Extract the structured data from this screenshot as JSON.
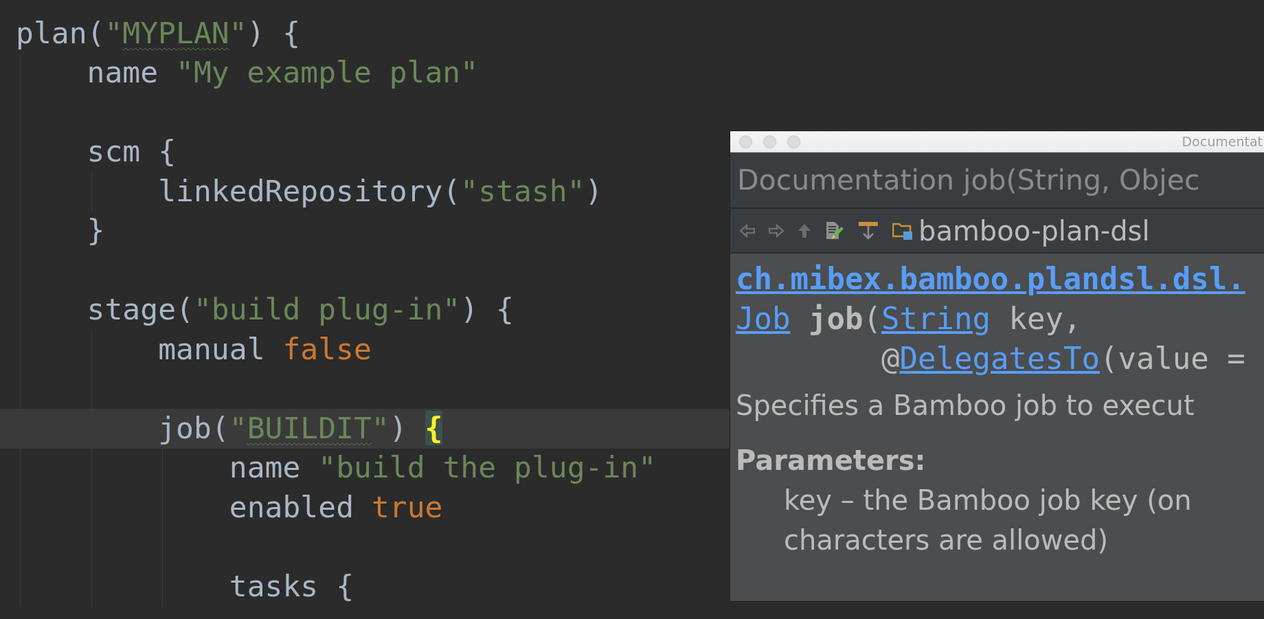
{
  "editor": {
    "lines": [
      {
        "current": false,
        "tokens": [
          {
            "text": "plan(",
            "kind": "plain"
          },
          {
            "text": "\"",
            "kind": "string"
          },
          {
            "text": "MYPLAN",
            "kind": "flagged_string"
          },
          {
            "text": "\"",
            "kind": "string"
          },
          {
            "text": ") {",
            "kind": "plain"
          }
        ]
      },
      {
        "current": false,
        "tokens": [
          {
            "text": "    name ",
            "kind": "plain"
          },
          {
            "text": "\"My example plan\"",
            "kind": "string"
          }
        ]
      },
      {
        "current": false
      },
      {
        "current": false,
        "tokens": [
          {
            "text": "    scm {",
            "kind": "plain"
          }
        ]
      },
      {
        "current": false,
        "tokens": [
          {
            "text": "        linkedRepository(",
            "kind": "plain"
          },
          {
            "text": "\"stash\"",
            "kind": "string"
          },
          {
            "text": ")",
            "kind": "plain"
          }
        ]
      },
      {
        "current": false,
        "tokens": [
          {
            "text": "    }",
            "kind": "plain"
          }
        ]
      },
      {
        "current": false
      },
      {
        "current": false,
        "tokens": [
          {
            "text": "    stage(",
            "kind": "plain"
          },
          {
            "text": "\"build plug-in\"",
            "kind": "string"
          },
          {
            "text": ") {",
            "kind": "plain"
          }
        ]
      },
      {
        "current": false,
        "tokens": [
          {
            "text": "        manual ",
            "kind": "plain"
          },
          {
            "text": "false",
            "kind": "keyword"
          }
        ]
      },
      {
        "current": false
      },
      {
        "current": true,
        "tokens": [
          {
            "text": "        job(",
            "kind": "plain"
          },
          {
            "text": "\"",
            "kind": "string"
          },
          {
            "text": "BUILDIT",
            "kind": "flagged_string"
          },
          {
            "text": "\"",
            "kind": "string"
          },
          {
            "text": ") ",
            "kind": "plain"
          },
          {
            "text": "{",
            "kind": "matched_brace"
          }
        ]
      },
      {
        "current": false,
        "tokens": [
          {
            "text": "            name ",
            "kind": "plain"
          },
          {
            "text": "\"build the plug-in\"",
            "kind": "string"
          }
        ]
      },
      {
        "current": false,
        "tokens": [
          {
            "text": "            enabled ",
            "kind": "plain"
          },
          {
            "text": "true",
            "kind": "keyword"
          }
        ]
      },
      {
        "current": false
      },
      {
        "current": false,
        "tokens": [
          {
            "text": "            tasks {",
            "kind": "plain"
          }
        ]
      }
    ]
  },
  "documentation_popup": {
    "window_title": "Documentat",
    "header": "Documentation job(String, Objec",
    "location": "bamboo-plan-dsl",
    "package_link": "ch.mibex.bamboo.plandsl.dsl.",
    "signature": [
      [
        {
          "text": "Job",
          "kind": "link"
        },
        {
          "text": " job",
          "kind": "bold"
        },
        {
          "text": "(",
          "kind": "plain"
        },
        {
          "text": "String",
          "kind": "link"
        },
        {
          "text": " key,",
          "kind": "plain"
        }
      ],
      [
        {
          "text": "        @",
          "kind": "plain"
        },
        {
          "text": "DelegatesTo",
          "kind": "link"
        },
        {
          "text": "(value =",
          "kind": "plain"
        }
      ]
    ],
    "description": "Specifies a Bamboo job to execut",
    "parameters_heading": "Parameters:",
    "parameter_lines": [
      "key – the Bamboo job key (on",
      "characters are allowed)"
    ]
  }
}
